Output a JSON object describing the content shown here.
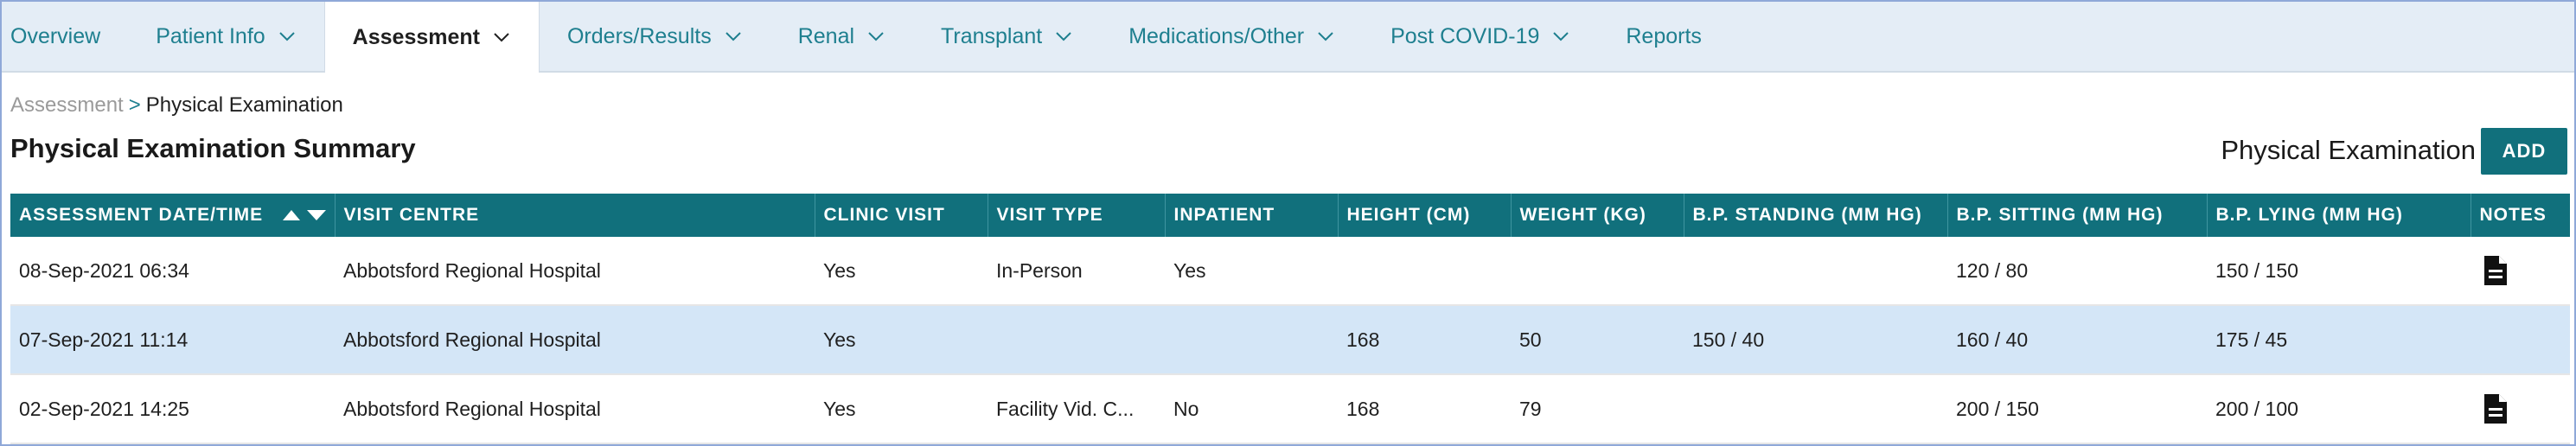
{
  "nav": {
    "tabs": [
      {
        "label": "Overview",
        "dropdown": false,
        "active": false
      },
      {
        "label": "Patient Info",
        "dropdown": true,
        "active": false
      },
      {
        "label": "Assessment",
        "dropdown": true,
        "active": true
      },
      {
        "label": "Orders/Results",
        "dropdown": true,
        "active": false
      },
      {
        "label": "Renal",
        "dropdown": true,
        "active": false
      },
      {
        "label": "Transplant",
        "dropdown": true,
        "active": false
      },
      {
        "label": "Medications/Other",
        "dropdown": true,
        "active": false
      },
      {
        "label": "Post COVID-19",
        "dropdown": true,
        "active": false
      },
      {
        "label": "Reports",
        "dropdown": false,
        "active": false
      }
    ]
  },
  "breadcrumb": {
    "parent": "Assessment",
    "separator": ">",
    "current": "Physical Examination"
  },
  "page": {
    "title": "Physical Examination Summary",
    "section_label": "Physical Examination",
    "add_label": "ADD"
  },
  "table": {
    "columns": [
      "ASSESSMENT DATE/TIME",
      "VISIT CENTRE",
      "CLINIC VISIT",
      "VISIT TYPE",
      "INPATIENT",
      "HEIGHT (CM)",
      "WEIGHT (KG)",
      "B.P. STANDING (MM HG)",
      "B.P. SITTING (MM HG)",
      "B.P. LYING (MM HG)",
      "NOTES"
    ],
    "rows": [
      {
        "date": "08-Sep-2021 06:34",
        "centre": "Abbotsford Regional Hospital",
        "clinic": "Yes",
        "type": "In-Person",
        "inpatient": "Yes",
        "height": "",
        "weight": "",
        "standing": "",
        "sitting": "120 / 80",
        "lying": "150 / 150",
        "has_note": true,
        "highlighted": false
      },
      {
        "date": "07-Sep-2021 11:14",
        "centre": "Abbotsford Regional Hospital",
        "clinic": "Yes",
        "type": "",
        "inpatient": "",
        "height": "168",
        "weight": "50",
        "standing": "150 / 40",
        "sitting": "160 / 40",
        "lying": "175 / 45",
        "has_note": false,
        "highlighted": true
      },
      {
        "date": "02-Sep-2021 14:25",
        "centre": "Abbotsford Regional Hospital",
        "clinic": "Yes",
        "type": "Facility Vid. C...",
        "inpatient": "No",
        "height": "168",
        "weight": "79",
        "standing": "",
        "sitting": "200 / 150",
        "lying": "200 / 100",
        "has_note": true,
        "highlighted": false
      }
    ]
  },
  "colors": {
    "accent": "#11707c",
    "nav_bg": "#e4edf6",
    "link": "#1e7f8f",
    "row_highlight": "#d4e6f7"
  },
  "icons": {
    "tab_dropdown": "chevron-down-icon",
    "sort": "sort-arrows-icon",
    "note": "document-icon"
  }
}
